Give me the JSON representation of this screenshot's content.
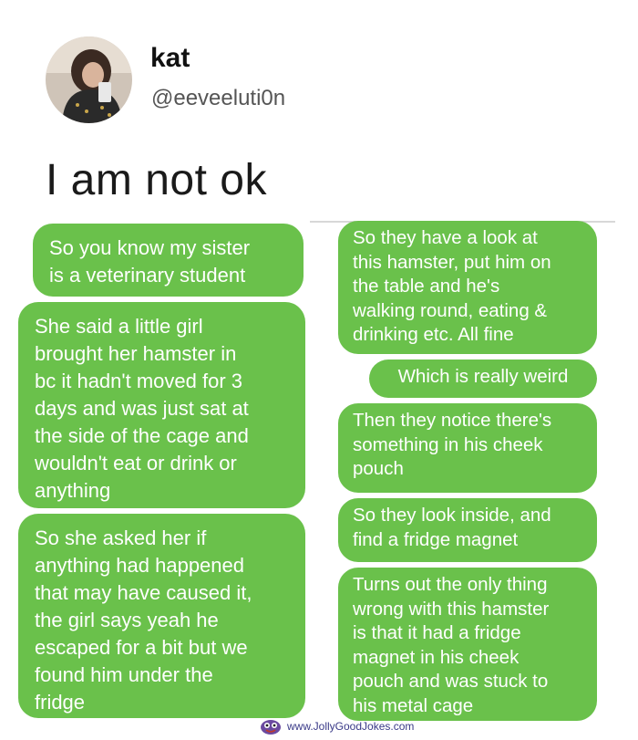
{
  "profile": {
    "name": "kat",
    "handle": "@eeveeluti0n"
  },
  "tweet_text": "I am not ok",
  "left_messages": [
    "So you know my sister\nis a veterinary student",
    "She said a little girl\nbrought her hamster in\nbc it hadn't moved for 3\ndays and was just sat at\nthe side of the cage and\nwouldn't eat or drink or\nanything",
    "So she asked her if\nanything had happened\nthat may have caused it,\nthe girl says yeah he\nescaped for a bit but we\nfound him under the\nfridge"
  ],
  "right_messages": [
    "So they have a look at\nthis hamster, put him on\nthe table and he's\nwalking round, eating &\ndrinking etc. All fine",
    "Which is really weird",
    "Then they notice there's\nsomething in his cheek\npouch",
    "So they look inside, and\nfind a fridge magnet",
    "Turns out the only thing\nwrong with this hamster\nis that it had a fridge\nmagnet in his cheek\npouch and was stuck to\nhis metal cage"
  ],
  "colors": {
    "bubble": "#6ac14b",
    "bubble_text": "#ffffff"
  },
  "watermark": {
    "text": "www.JollyGoodJokes.com",
    "icon": "cartoon-face-icon"
  }
}
